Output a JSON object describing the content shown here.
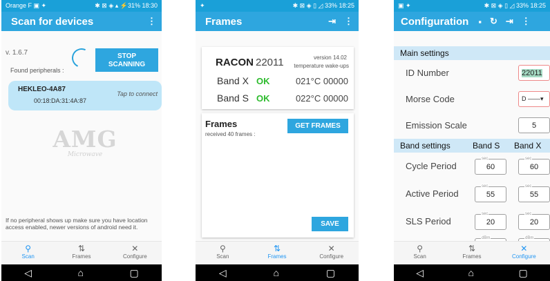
{
  "scan_screen": {
    "status": {
      "left": "Orange F  ▣  ✦",
      "right": "✱ ⊠ ◈  ▴ ⚡31%  18:30"
    },
    "title": "Scan for devices",
    "menu_icon": "more-vert-icon",
    "version": "v. 1.6.7",
    "stop_label_1": "STOP",
    "stop_label_2": "SCANNING",
    "found_label": "Found peripherals :",
    "device": {
      "name": "HEKLEO-4A87",
      "mac": "00:18:DA:31:4A:87",
      "action": "Tap to connect"
    },
    "logo": {
      "main": "AMG",
      "sub": "Microwave"
    },
    "note": "If no peripheral shows up make sure you have location access enabled, newer versions of android need it."
  },
  "frames_screen": {
    "status": {
      "left": "✦",
      "right": "✱ ⊠ ◈  ▯ ◿  33% 18:25"
    },
    "title": "Frames",
    "exit_icon": "exit-icon",
    "racon_label": "RACON",
    "racon_number": "22011",
    "version": "version 14.02",
    "temp_wakeups": "temperature wake-ups",
    "bands": [
      {
        "name": "Band X",
        "status": "OK",
        "value": "021°C 00000"
      },
      {
        "name": "Band S",
        "status": "OK",
        "value": "022°C 00000"
      }
    ],
    "frames_title": "Frames",
    "get_frames_label": "GET FRAMES",
    "received": "received 40 frames :",
    "save_label": "SAVE"
  },
  "config_screen": {
    "status": {
      "left": "▣  ✦",
      "right": "✱ ⊠ ◈  ▯ ◿  33% 18:25"
    },
    "title": "Configuration",
    "main_settings": "Main settings",
    "id_label": "ID Number",
    "id_value": "22011",
    "morse_label": "Morse Code",
    "morse_value": "D ——▾",
    "emission_label": "Emission Scale",
    "emission_value": "5",
    "band_settings": "Band settings",
    "band_s": "Band S",
    "band_x": "Band X",
    "unit_sec": "sec",
    "unit_dbm": "dBm",
    "rows": [
      {
        "label": "Cycle Period",
        "s": "60",
        "x": "60"
      },
      {
        "label": "Active Period",
        "s": "55",
        "x": "55"
      },
      {
        "label": "SLS Period",
        "s": "20",
        "x": "20"
      }
    ]
  },
  "bottom_nav": {
    "scan": "Scan",
    "frames": "Frames",
    "configure": "Configure"
  },
  "system_nav": {
    "back": "◁",
    "home": "⌂",
    "recents": "▢"
  },
  "colors": {
    "primary": "#2ea6df",
    "status": "#1aa0d8",
    "ok": "#2cbb2c",
    "active": "#2196f3"
  }
}
